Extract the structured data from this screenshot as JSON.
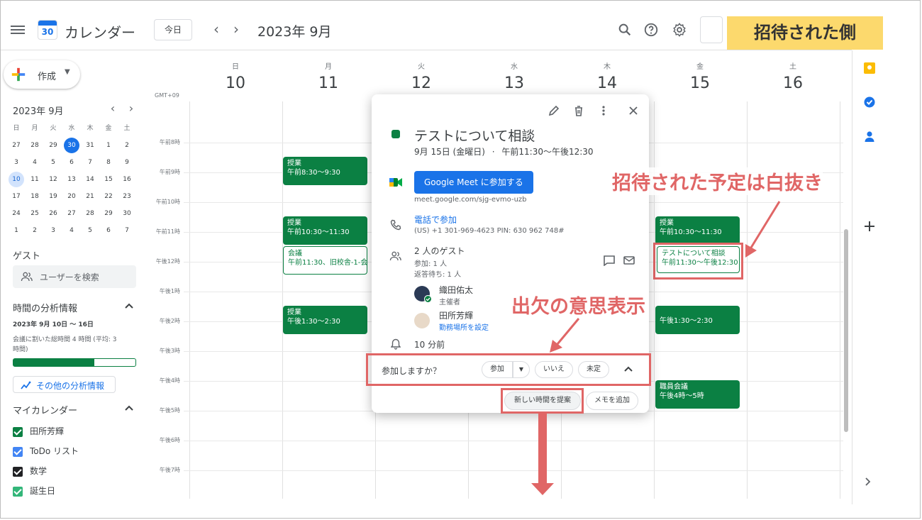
{
  "header": {
    "app_title": "カレンダー",
    "logo_number": "30",
    "today_button": "今日",
    "month_title": "2023年 9月",
    "prev_label": "‹",
    "next_label": "›",
    "badge": "招待された側"
  },
  "sidebar": {
    "create_label": "作成",
    "mini_title": "2023年 9月",
    "weekday_heads": [
      "日",
      "月",
      "火",
      "水",
      "木",
      "金",
      "土"
    ],
    "weeks": [
      [
        "27",
        "28",
        "29",
        "30",
        "31",
        "1",
        "2"
      ],
      [
        "3",
        "4",
        "5",
        "6",
        "7",
        "8",
        "9"
      ],
      [
        "10",
        "11",
        "12",
        "13",
        "14",
        "15",
        "16"
      ],
      [
        "17",
        "18",
        "19",
        "20",
        "21",
        "22",
        "23"
      ],
      [
        "24",
        "25",
        "26",
        "27",
        "28",
        "29",
        "30"
      ],
      [
        "1",
        "2",
        "3",
        "4",
        "5",
        "6",
        "7"
      ]
    ],
    "guests_title": "ゲスト",
    "search_placeholder": "ユーザーを検索",
    "analysis_title": "時間の分析情報",
    "analysis_range": "2023年 9月 10日 〜 16日",
    "analysis_text_1": "会議に割いた総時間 4 時間 (平均: 3",
    "analysis_text_2": "時間)",
    "analysis_progress": 0.66,
    "more_analysis": "その他の分析情報",
    "my_calendars_title": "マイカレンダー",
    "calendars": [
      {
        "name": "田所芳輝",
        "color": "#0b8043"
      },
      {
        "name": "ToDo リスト",
        "color": "#4285f4"
      },
      {
        "name": "数学",
        "color": "#202124"
      },
      {
        "name": "誕生日",
        "color": "#33b679"
      }
    ]
  },
  "grid": {
    "timezone": "GMT+09",
    "days": [
      {
        "name": "日",
        "num": "10"
      },
      {
        "name": "月",
        "num": "11"
      },
      {
        "name": "火",
        "num": "12"
      },
      {
        "name": "水",
        "num": "13"
      },
      {
        "name": "木",
        "num": "14"
      },
      {
        "name": "金",
        "num": "15"
      },
      {
        "name": "土",
        "num": "16"
      }
    ],
    "times": [
      "午前8時",
      "午前9時",
      "午前10時",
      "午前11時",
      "午後12時",
      "午後1時",
      "午後2時",
      "午後3時",
      "午後4時",
      "午後5時",
      "午後6時",
      "午後7時"
    ],
    "events": [
      {
        "title": "授業",
        "time": "午前8:30〜9:30"
      },
      {
        "title": "授業",
        "time": "午前10:30〜11:30"
      },
      {
        "title": "会議",
        "time": "午前11:30、旧校舎-1-会"
      },
      {
        "title": "授業",
        "time": "午後1:30〜2:30"
      },
      {
        "title": "授業",
        "time": "午前10:30〜11:30"
      },
      {
        "title": "テストについて相談",
        "time": "午前11:30〜午後12:30"
      },
      {
        "title": "",
        "time": "午後1:30〜2:30"
      },
      {
        "title": "職員会議",
        "time": "午後4時〜5時"
      }
    ]
  },
  "popup": {
    "title": "テストについて相談",
    "date": "9月 15日 (金曜日)",
    "separator": "·",
    "time": "午前11:30〜午後12:30",
    "meet_button": "Google Meet に参加する",
    "meet_url": "meet.google.com/sjg-evmo-uzb",
    "phone_link": "電話で参加",
    "phone_info": "(US) +1 301-969-4623 PIN: 630 962 748#",
    "guests_count": "2 人のゲスト",
    "guests_yes": "参加: 1 人",
    "guests_pending": "返答待ち: 1 人",
    "guest1_name": "織田佑太",
    "guest1_role": "主催者",
    "guest2_name": "田所芳輝",
    "guest2_link": "勤務場所を設定",
    "reminder": "10 分前",
    "rsvp_question": "参加しますか？",
    "rsvp_yes": "参加",
    "rsvp_no": "いいえ",
    "rsvp_maybe": "未定",
    "propose_button": "新しい時間を提案",
    "add_note_button": "メモを追加"
  },
  "annotations": {
    "invited_white": "招待された予定は白抜き",
    "rsvp_label": "出欠の意思表示"
  },
  "colors": {
    "accent": "#1a73e8",
    "event_green": "#0b8043",
    "annotation_red": "#e06666",
    "badge_yellow": "#fcd96d"
  }
}
